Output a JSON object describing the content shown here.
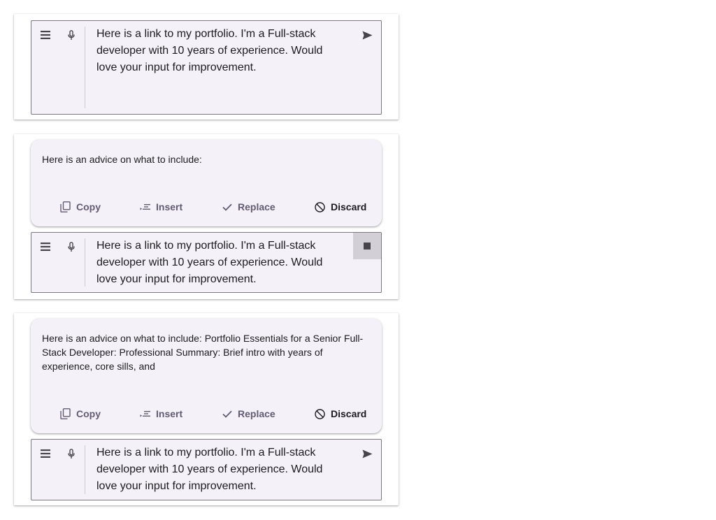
{
  "composer": {
    "prompt_text": "Here is a link to my portfolio. I'm a Full-stack developer with 10 years of experience. Would love your input for improvement."
  },
  "response_short": {
    "text": "Here is an advice on what to include:"
  },
  "response_long": {
    "text": "Here is an advice on what to include: Portfolio Essentials for a Senior Full-Stack Developer: Professional Summary: Brief intro with years of experience, core sills, and"
  },
  "actions": {
    "copy_label": "Copy",
    "insert_label": "Insert",
    "replace_label": "Replace",
    "discard_label": "Discard"
  },
  "icons": {
    "menu": "menu-icon",
    "mic": "mic-icon",
    "send": "send-icon",
    "stop": "stop-icon",
    "copy": "copy-icon",
    "insert": "insert-icon",
    "replace": "check-icon",
    "discard": "block-icon"
  },
  "colors": {
    "surface": "#f4f2f8",
    "outline": "#7a7780",
    "action_text": "#625b71",
    "text": "#1c1b1f"
  }
}
